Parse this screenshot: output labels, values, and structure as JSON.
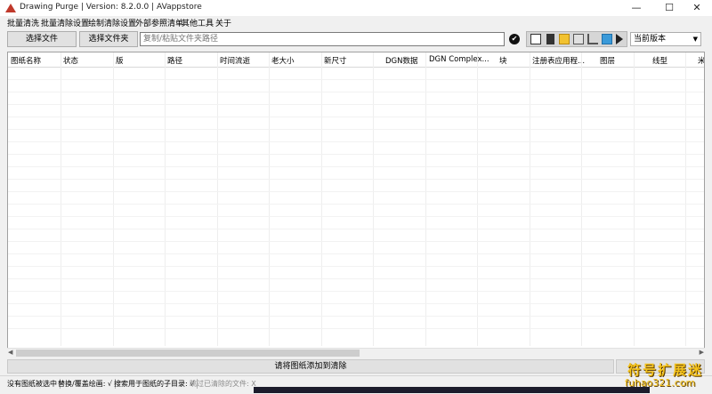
{
  "window": {
    "title": "Drawing Purge  | Version: 8.2.0.0  |   AVappstore",
    "min_glyph": "—",
    "max_glyph": "☐",
    "close_glyph": "✕"
  },
  "menu": [
    "批量清洗",
    "批量清除设置",
    "绘制清除设置",
    "外部参照清单",
    "其他工具",
    "关于"
  ],
  "toolbar": {
    "select_file_label": "选择文件",
    "select_folder_label": "选择文件夹",
    "path_placeholder": "复制/粘贴文件夹路径",
    "check_glyph": "✔",
    "version_value": "当前版本",
    "version_arrow": "▼",
    "icons": [
      "list-icon",
      "delete-icon",
      "folder-icon",
      "export-icon",
      "tree-icon",
      "open-external-icon",
      "skip-end-icon"
    ]
  },
  "table": {
    "columns": [
      "图纸名称",
      "状态",
      "版",
      "路径",
      "时间流逝",
      "老大小",
      "新尺寸",
      "DGN数据",
      "DGN Complex...",
      "块",
      "注册表应用程...",
      "图层",
      "线型",
      "米"
    ]
  },
  "scroll": {
    "left_arrow": "◀",
    "right_arrow": "▶"
  },
  "action": {
    "add_drawings_label": "请将图纸添加到清除"
  },
  "status": {
    "no_selection": "没有图纸被选中",
    "replace_overwrite": "替换/覆盖绘画: √",
    "search_subdirs": "搜索用于图纸的子目录: √",
    "skip_cleaned": "跳过已清除的文件: X"
  },
  "watermark": {
    "text": "符号扩展迷",
    "url": "fuhao321.com"
  }
}
